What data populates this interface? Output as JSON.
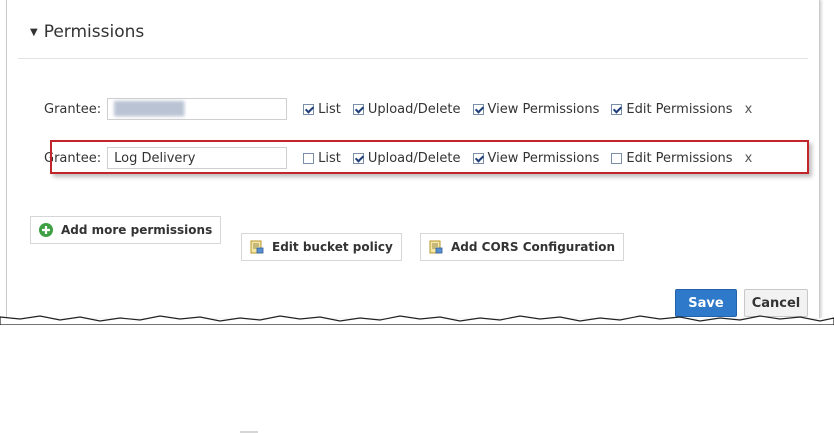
{
  "section": {
    "title": "Permissions",
    "caret_icon": "caret-down-icon"
  },
  "grantees": [
    {
      "label": "Grantee:",
      "value": "███████",
      "value_obscured": true,
      "permissions": [
        {
          "label": "List",
          "checked": true
        },
        {
          "label": "Upload/Delete",
          "checked": true
        },
        {
          "label": "View Permissions",
          "checked": true
        },
        {
          "label": "Edit Permissions",
          "checked": true
        }
      ],
      "remove_label": "x"
    },
    {
      "label": "Grantee:",
      "value": "Log Delivery",
      "value_obscured": false,
      "highlighted": true,
      "permissions": [
        {
          "label": "List",
          "checked": false
        },
        {
          "label": "Upload/Delete",
          "checked": true
        },
        {
          "label": "View Permissions",
          "checked": true
        },
        {
          "label": "Edit Permissions",
          "checked": false
        }
      ],
      "remove_label": "x"
    }
  ],
  "actions": {
    "add_more": "Add more permissions",
    "edit_policy": "Edit bucket policy",
    "add_cors": "Add CORS Configuration",
    "save": "Save",
    "cancel": "Cancel"
  },
  "colors": {
    "save_bg": "#2e79c9",
    "highlight_border": "#c0262c",
    "plus_green": "#3ea043"
  }
}
